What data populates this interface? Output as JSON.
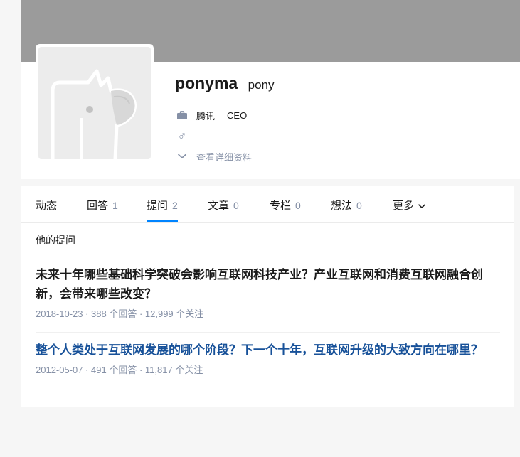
{
  "profile": {
    "name": "ponyma",
    "headline": "pony",
    "company": "腾讯",
    "title": "CEO",
    "gender_symbol": "♂",
    "more_info_label": "查看详细资料",
    "icons": {
      "briefcase": "briefcase-icon",
      "gender": "male-gender-icon",
      "expand": "chevron-down-icon"
    },
    "colors": {
      "cover": "#9b9b9b",
      "muted_icon": "#8590a6"
    }
  },
  "tabs": [
    {
      "label": "动态",
      "count": ""
    },
    {
      "label": "回答",
      "count": "1"
    },
    {
      "label": "提问",
      "count": "2",
      "active": true
    },
    {
      "label": "文章",
      "count": "0"
    },
    {
      "label": "专栏",
      "count": "0"
    },
    {
      "label": "想法",
      "count": "0"
    },
    {
      "label": "更多",
      "count": ""
    }
  ],
  "accent_color": "#0084ff",
  "section": {
    "title": "他的提问"
  },
  "questions": [
    {
      "title": "未来十年哪些基础科学突破会影响互联网科技产业？产业互联网和消费互联网融合创新，会带来哪些改变？",
      "meta": "2018-10-23 · 388 个回答 · 12,999 个关注"
    },
    {
      "title": "整个人类处于互联网发展的哪个阶段？下一个十年，互联网升级的大致方向在哪里？",
      "meta": "2012-05-07 · 491 个回答 · 11,817 个关注"
    }
  ]
}
